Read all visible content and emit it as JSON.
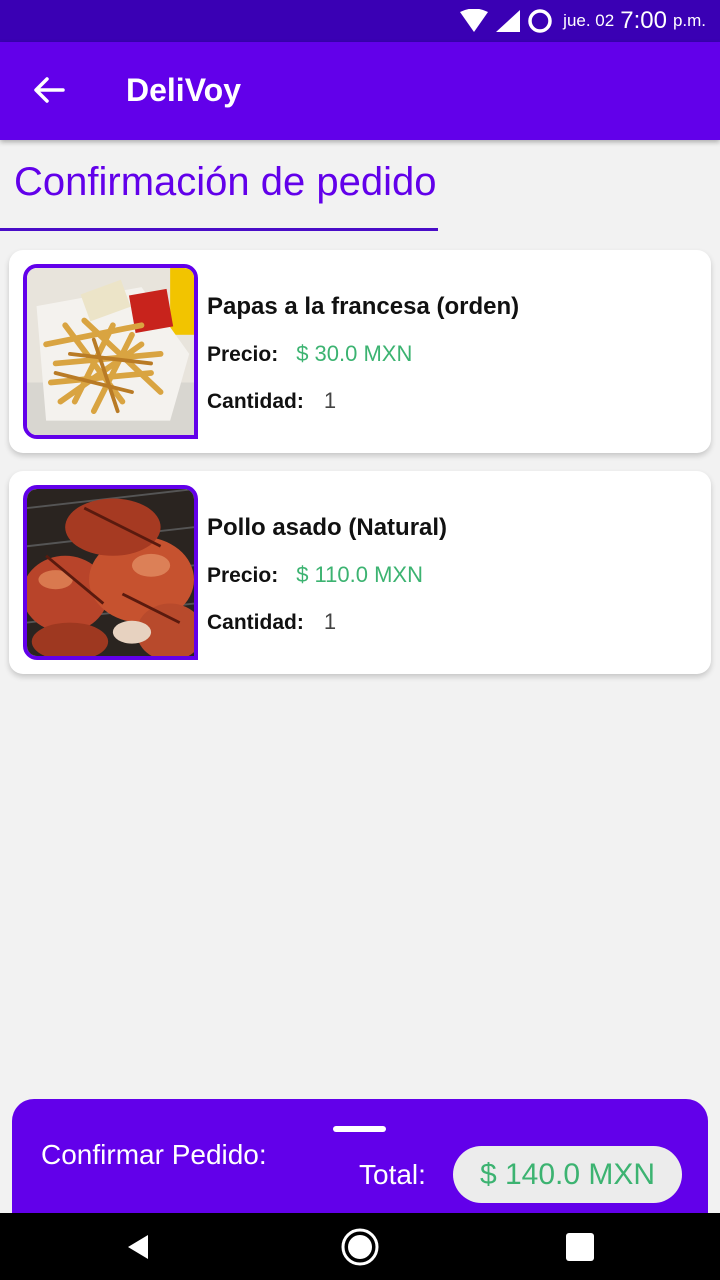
{
  "status_bar": {
    "date": "jue. 02",
    "time": "7:00",
    "ampm": "p.m."
  },
  "app_bar": {
    "title": "DeliVoy",
    "back_icon": "arrow-left-icon"
  },
  "page": {
    "title": "Confirmación de pedido"
  },
  "order_items": [
    {
      "name": "Papas a la francesa (orden)",
      "price_label": "Precio:",
      "price": "$  30.0 MXN",
      "quantity_label": "Cantidad:",
      "quantity": "1",
      "image": "french-fries-photo"
    },
    {
      "name": "Pollo asado (Natural)",
      "price_label": "Precio:",
      "price": "$  110.0 MXN",
      "quantity_label": "Cantidad:",
      "quantity": "1",
      "image": "roast-chicken-photo"
    }
  ],
  "bottom_sheet": {
    "confirm_label": "Confirmar Pedido:",
    "total_label": "Total:",
    "total_value": "$ 140.0 MXN"
  },
  "colors": {
    "primary": "#6200ea",
    "status_bar": "#3a00b4",
    "price_green": "#3cb371",
    "background": "#f2f2f2"
  }
}
